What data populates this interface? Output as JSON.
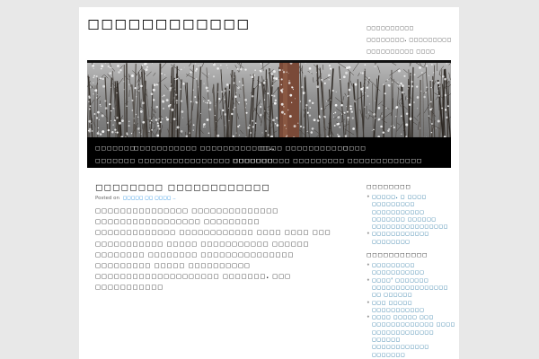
{
  "site": {
    "title": "◻◻◻◻◻◻◻◻◻◻◻◻",
    "description": "◻◻◻◻◻◻◻◻◻◻ ◻◻◻◻◻◻◻◻. ◻◻◻◻◻◻◻◻◻ ◻◻◻◻◻◻◻◻◻◻ ◻◻◻◻ ◻◻◻◻◻◻◻◻◻◻◻◻◻ ◻◻◻◻"
  },
  "nav": {
    "items": [
      "◻◻◻◻◻◻◻",
      "◻◻◻◻◻◻◻◻◻◻◻ ◻◻◻◻◻◻◻◻◻◻◻◻..",
      "◻◻◻◻ ◻◻◻◻◻◻◻◻◻◻◻",
      "◻◻◻◻",
      "◻◻◻◻◻◻◻ ◻◻◻◻◻◻◻◻◻◻◻◻◻◻◻◻ ◻◻◻◻◻◻◻",
      "◻◻◻◻◻◻◻◻◻◻ ◻◻◻◻◻◻◻◻◻ ◻◻◻◻◻◻◻◻◻◻◻◻◻"
    ]
  },
  "post": {
    "title": "◻◻◻◻◻◻◻◻ ◻◻◻◻◻◻◻◻◻◻◻◻",
    "meta_prefix": "Posted on",
    "date": "◻◻◻◻◻ ◻◻ ◻◻◻◻ ..",
    "body": "◻◻◻◻◻◻◻◻◻◻◻◻◻◻◻ ◻◻◻◻◻◻◻◻◻◻◻◻◻◻ ◻◻◻◻◻◻◻◻◻◻◻◻◻◻◻◻◻ ◻◻◻◻◻◻◻◻◻ ◻◻◻◻◻◻◻◻◻◻◻◻◻ ◻◻◻◻◻◻◻◻◻◻◻◻ ◻◻◻◻ ◻◻◻◻ ◻◻◻ ◻◻◻◻◻◻◻◻◻◻◻ ◻◻◻◻◻ ◻◻◻◻◻◻◻◻◻◻◻ ◻◻◻◻◻◻ ◻◻◻◻◻◻◻◻ ◻◻◻◻◻◻◻◻ ◻◻◻◻◻◻◻◻◻◻◻◻◻◻◻ ◻◻◻◻◻◻◻◻◻ ◻◻◻◻◻ ◻◻◻◻◻◻◻◻◻◻ ◻◻◻◻◻◻◻◻◻◻◻◻◻◻◻◻◻◻◻◻ ◻◻◻◻◻◻◻. ◻◻◻ ◻◻◻◻◻◻◻◻◻◻◻"
  },
  "sidebar": {
    "widget1": {
      "title": "◻◻◻◻◻◻◻◻",
      "items": [
        "◻◻◻◻◻. ◻ ◻◻◻◻ ◻◻◻◻◻◻◻◻◻ ◻◻◻◻◻◻◻◻◻◻◻ ◻◻◻◻◻◻◻ ◻◻◻◻◻◻ ◻◻◻◻◻◻◻◻◻◻◻◻◻◻◻◻",
        "◻◻◻◻◻◻◻◻◻◻◻◻ ◻◻◻◻◻◻◻◻"
      ]
    },
    "widget2": {
      "title": "◻◻◻◻◻◻◻◻◻◻◻",
      "items": [
        "◻◻◻◻◻◻◻◻◻ ◻◻◻◻◻◻◻◻◻◻◻",
        "◻◻◻◻' ◻◻◻◻◻◻◻ ◻◻◻◻◻◻◻◻◻◻◻◻◻◻◻◻ ◻◻ ◻◻◻◻◻◻",
        "◻◻◻ ◻◻◻◻◻ ◻◻◻◻◻◻◻◻◻◻◻",
        "◻◻◻◻ ◻◻◻◻◻ ◻◻◻ ◻◻◻◻◻◻◻◻◻◻◻◻◻ ◻◻◻◻ ◻◻◻◻◻◻◻◻◻◻◻◻◻ ◻◻◻◻◻◻ ◻◻◻◻◻◻◻◻◻◻◻◻ ◻◻◻◻◻◻◻"
      ]
    }
  }
}
